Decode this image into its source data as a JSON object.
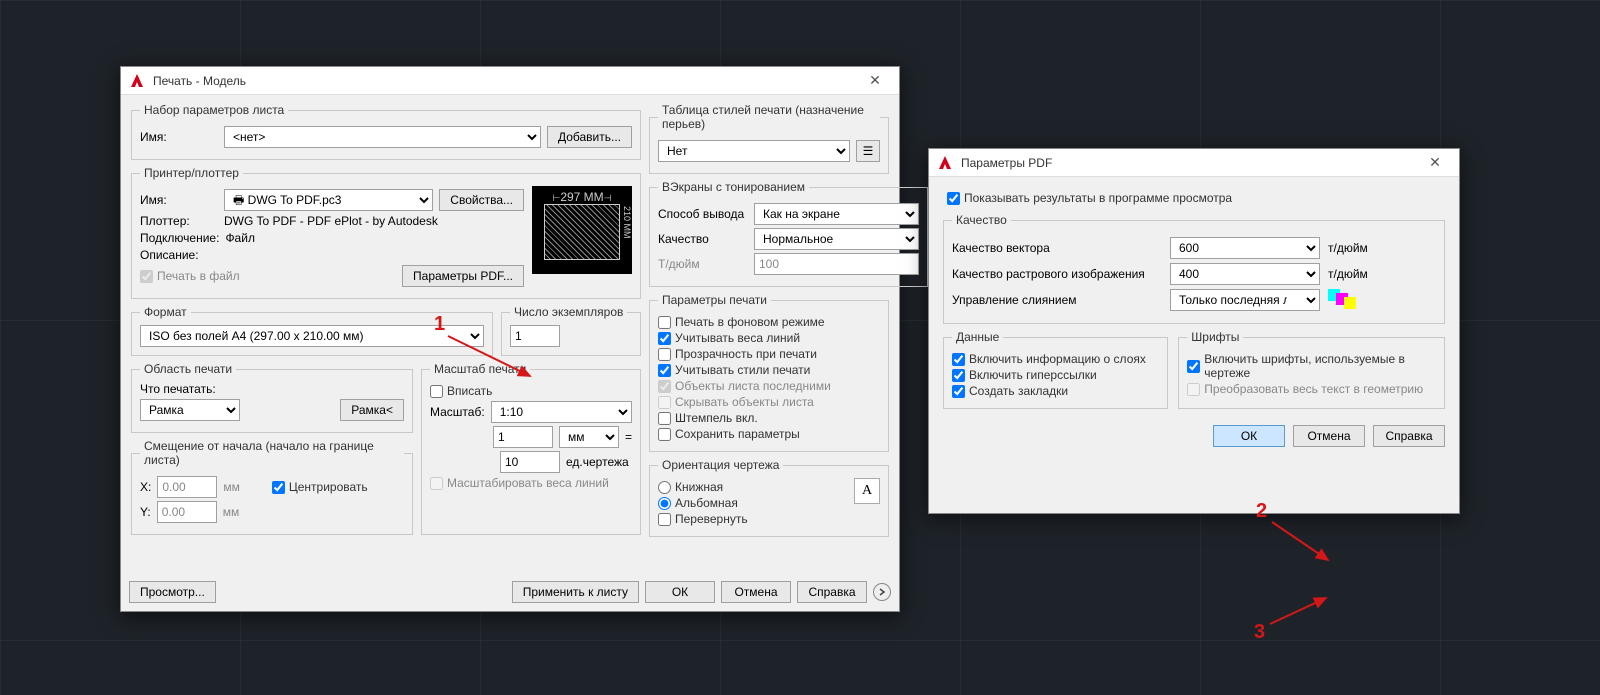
{
  "plot": {
    "title": "Печать - Модель",
    "pageSetup": {
      "legend": "Набор параметров листа",
      "nameLabel": "Имя:",
      "nameValue": "<нет>",
      "addBtn": "Добавить..."
    },
    "printer": {
      "legend": "Принтер/плоттер",
      "nameLabel": "Имя:",
      "nameValue": "DWG To PDF.pc3",
      "propsBtn": "Свойства...",
      "plotterLabel": "Плоттер:",
      "plotterValue": "DWG To PDF - PDF ePlot - by Autodesk",
      "connectLabel": "Подключение:",
      "connectValue": "Файл",
      "descLabel": "Описание:",
      "toFileLabel": "Печать в файл",
      "pdfOptBtn": "Параметры PDF...",
      "previewW": "297 MM",
      "previewH": "210 MM"
    },
    "format": {
      "legend": "Формат",
      "value": "ISO без полей A4 (297.00 x 210.00 мм)"
    },
    "copies": {
      "legend": "Число экземпляров",
      "value": "1"
    },
    "area": {
      "legend": "Область печати",
      "whatLabel": "Что печатать:",
      "value": "Рамка",
      "windowBtn": "Рамка<"
    },
    "offset": {
      "legend": "Смещение от начала (начало на границе листа)",
      "xLabel": "X:",
      "xValue": "0.00",
      "yLabel": "Y:",
      "yValue": "0.00",
      "unit": "мм",
      "centerLabel": "Центрировать"
    },
    "scale": {
      "legend": "Масштаб печати",
      "fitLabel": "Вписать",
      "scaleLabel": "Масштаб:",
      "scaleValue": "1:10",
      "numValue": "1",
      "unit": "мм",
      "denValue": "10",
      "denUnit": "ед.чертежа",
      "lwLabel": "Масштабировать веса линий"
    },
    "plotStyle": {
      "legend": "Таблица стилей печати (назначение перьев)",
      "value": "Нет"
    },
    "shaded": {
      "legend": "ВЭкраны с тонированием",
      "modeLabel": "Способ вывода",
      "modeValue": "Как на экране",
      "qualityLabel": "Качество",
      "qualityValue": "Нормальное",
      "dpiLabel": "Т/дюйм",
      "dpiValue": "100"
    },
    "options": {
      "legend": "Параметры печати",
      "bg": "Печать в фоновом режиме",
      "lw": "Учитывать веса линий",
      "transp": "Прозрачность при печати",
      "styles": "Учитывать стили печати",
      "paperLast": "Объекты листа последними",
      "hide": "Скрывать объекты листа",
      "stamp": "Штемпель вкл.",
      "save": "Сохранить параметры"
    },
    "orient": {
      "legend": "Ориентация чертежа",
      "portrait": "Книжная",
      "landscape": "Альбомная",
      "upside": "Перевернуть"
    },
    "footer": {
      "preview": "Просмотр...",
      "apply": "Применить к листу",
      "ok": "ОК",
      "cancel": "Отмена",
      "help": "Справка"
    }
  },
  "pdf": {
    "title": "Параметры PDF",
    "showViewer": "Показывать результаты в программе просмотра",
    "quality": {
      "legend": "Качество",
      "vectorLabel": "Качество вектора",
      "vectorValue": "600",
      "rasterLabel": "Качество растрового изображения",
      "rasterValue": "400",
      "unit": "т/дюйм",
      "mergeLabel": "Управление слиянием",
      "mergeValue": "Только последняя линия"
    },
    "data": {
      "legend": "Данные",
      "layers": "Включить информацию о слоях",
      "hyperlinks": "Включить гиперссылки",
      "bookmarks": "Создать закладки"
    },
    "fonts": {
      "legend": "Шрифты",
      "include": "Включить шрифты, используемые в чертеже",
      "convert": "Преобразовать весь текст в геометрию"
    },
    "footer": {
      "ok": "ОК",
      "cancel": "Отмена",
      "help": "Справка"
    }
  },
  "anno": {
    "n1": "1",
    "n2": "2",
    "n3": "3"
  }
}
